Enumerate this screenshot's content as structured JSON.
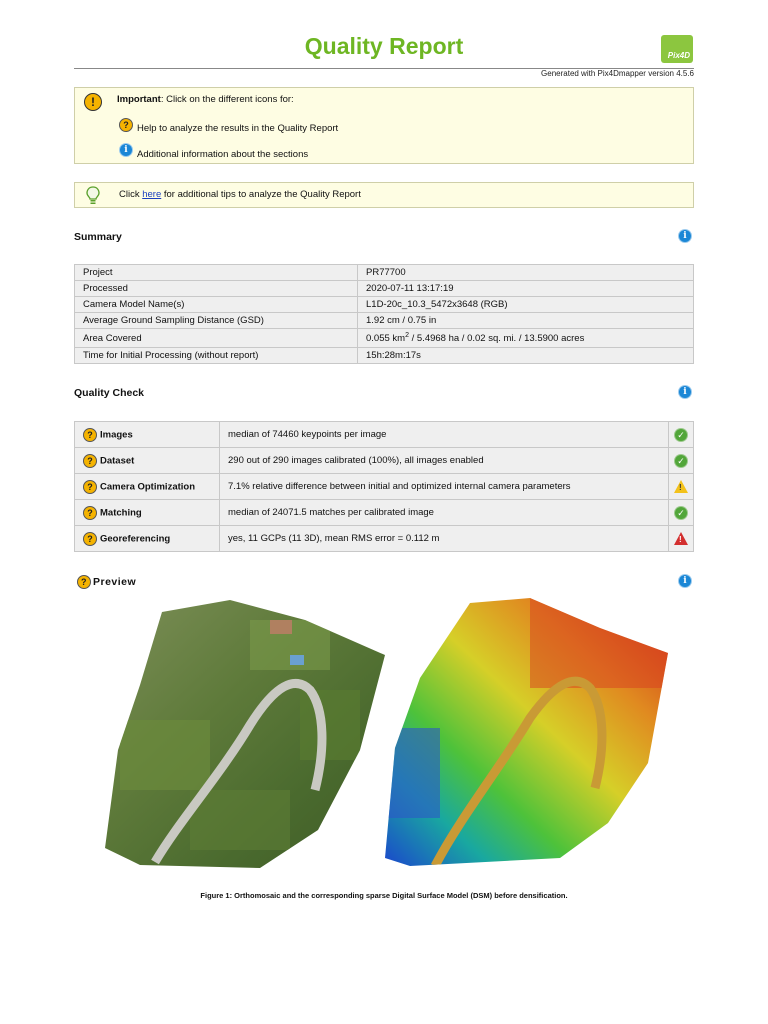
{
  "header": {
    "title": "Quality Report",
    "logo_text": "Pix4D",
    "generated": "Generated with Pix4Dmapper version 4.5.6"
  },
  "important": {
    "label": "Important",
    "text": ": Click on the different icons for:",
    "item1": "Help to analyze the results in the Quality Report",
    "item2": "Additional information about the sections"
  },
  "tip": {
    "prefix": "Click ",
    "link": "here",
    "suffix": " for additional tips to analyze the Quality Report"
  },
  "summary": {
    "title": "Summary",
    "rows": [
      {
        "key": "Project",
        "value": "PR77700"
      },
      {
        "key": "Processed",
        "value": "2020-07-11 13:17:19"
      },
      {
        "key": "Camera Model Name(s)",
        "value": "L1D-20c_10.3_5472x3648 (RGB)"
      },
      {
        "key": "Average Ground Sampling Distance (GSD)",
        "value": "1.92 cm / 0.75 in"
      },
      {
        "key": "Area Covered",
        "value_a": "0.055 km",
        "value_sup": "2",
        "value_b": " / 5.4968 ha / 0.02 sq. mi. / 13.5900 acres"
      },
      {
        "key": "Time for Initial Processing (without report)",
        "value": "15h:28m:17s"
      }
    ]
  },
  "quality": {
    "title": "Quality Check",
    "rows": [
      {
        "key": "Images",
        "value": "median of 74460 keypoints per image",
        "status": "ok"
      },
      {
        "key": "Dataset",
        "value": "290 out of 290 images calibrated (100%), all images enabled",
        "status": "ok"
      },
      {
        "key": "Camera Optimization",
        "value": "7.1% relative difference between initial and optimized internal camera parameters",
        "status": "warning"
      },
      {
        "key": "Matching",
        "value": "median of 24071.5 matches per calibrated image",
        "status": "ok"
      },
      {
        "key": "Georeferencing",
        "value": "yes, 11 GCPs (11 3D), mean RMS error = 0.112 m",
        "status": "error"
      }
    ]
  },
  "preview": {
    "title": "Preview",
    "caption": "Figure 1: Orthomosaic and the corresponding sparse Digital Surface Model (DSM) before densification."
  },
  "icons": {
    "warn": "!",
    "help": "?",
    "info": "i",
    "ok": "✓",
    "alert": "!"
  },
  "colors": {
    "accent": "#6eb623",
    "info_blue": "#1b87d6",
    "help_orange": "#f5b300",
    "ok_green": "#52a63a",
    "warn_yellow": "#f3c21b",
    "error_red": "#d32f2f"
  }
}
